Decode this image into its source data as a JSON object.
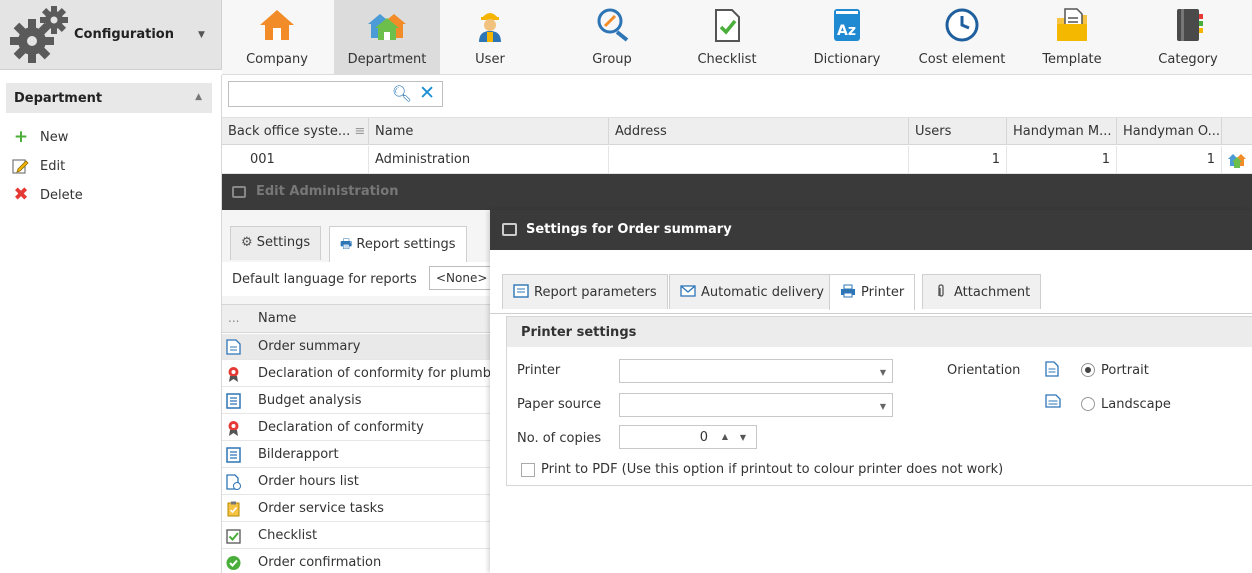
{
  "config": {
    "title": "Configuration"
  },
  "toolbar": {
    "items": [
      {
        "label": "Company",
        "icon": "house-icon"
      },
      {
        "label": "Department",
        "icon": "department-houses-icon"
      },
      {
        "label": "User",
        "icon": "worker-icon"
      },
      {
        "label": "Group",
        "icon": "group-wrench-icon"
      },
      {
        "label": "Checklist",
        "icon": "checklist-icon"
      },
      {
        "label": "Dictionary",
        "icon": "dictionary-icon"
      },
      {
        "label": "Cost element",
        "icon": "clock-icon"
      },
      {
        "label": "Template",
        "icon": "template-folder-icon"
      },
      {
        "label": "Category",
        "icon": "category-book-icon"
      }
    ]
  },
  "sidebar": {
    "header": "Department",
    "actions": [
      {
        "label": "New"
      },
      {
        "label": "Edit"
      },
      {
        "label": "Delete"
      }
    ]
  },
  "search": {
    "value": ""
  },
  "grid": {
    "columns": [
      "Back office syste...",
      "Name",
      "Address",
      "Users",
      "Handyman M...",
      "Handyman O..."
    ],
    "rows": [
      {
        "code": "001",
        "name": "Administration",
        "address": "",
        "users": "1",
        "handyman_m": "1",
        "handyman_o": "1"
      }
    ]
  },
  "edit_window": {
    "title": "Edit Administration",
    "tabs": [
      {
        "label": "Settings"
      },
      {
        "label": "Report settings"
      }
    ],
    "default_language_label": "Default language for reports",
    "default_language_value": "<None>",
    "report_list_header_dots": "...",
    "report_list_header": "Name",
    "reports": [
      {
        "name": "Order summary",
        "icon": "report-doc-icon"
      },
      {
        "name": "Declaration of conformity for plumbers",
        "icon": "ribbon-badge-icon"
      },
      {
        "name": "Budget analysis",
        "icon": "blue-doc-icon"
      },
      {
        "name": "Declaration of conformity",
        "icon": "ribbon-badge-icon"
      },
      {
        "name": "Bilderapport",
        "icon": "blue-doc-icon"
      },
      {
        "name": "Order hours list",
        "icon": "doc-clock-icon"
      },
      {
        "name": "Order service tasks",
        "icon": "clipboard-icon"
      },
      {
        "name": "Checklist",
        "icon": "checkbox-icon"
      },
      {
        "name": "Order confirmation",
        "icon": "green-check-icon"
      }
    ]
  },
  "dialog": {
    "title": "Settings for Order summary",
    "tabs": [
      {
        "label": "Report parameters"
      },
      {
        "label": "Automatic delivery"
      },
      {
        "label": "Printer"
      },
      {
        "label": "Attachment"
      }
    ],
    "group_title": "Printer settings",
    "printer_label": "Printer",
    "printer_value": "",
    "paper_source_label": "Paper source",
    "paper_source_value": "",
    "copies_label": "No. of copies",
    "copies_value": "0",
    "orientation_label": "Orientation",
    "portrait_label": "Portrait",
    "landscape_label": "Landscape",
    "print_pdf_label": "Print to PDF (Use this option if printout to colour printer does not work)"
  }
}
